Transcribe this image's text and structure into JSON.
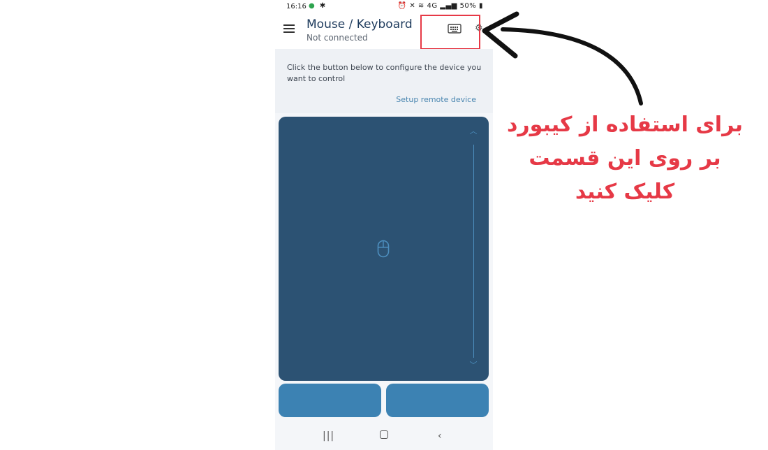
{
  "status_bar": {
    "time": "16:16",
    "battery": "50%",
    "signal_text": "4G"
  },
  "app_bar": {
    "title": "Mouse / Keyboard",
    "subtitle": "Not connected",
    "menu_icon": "hamburger-menu-icon",
    "keyboard_icon": "keyboard-icon",
    "settings_icon": "gear-icon"
  },
  "info_card": {
    "message": "Click the button below to configure the device you want to control",
    "action_label": "Setup remote device"
  },
  "touchpad": {
    "center_icon": "mouse-icon",
    "scroll_up_icon": "chevron-up-icon",
    "scroll_down_icon": "chevron-down-icon"
  },
  "nav_bar": {
    "recent_icon": "recent-apps-icon",
    "home_icon": "home-icon",
    "back_icon": "back-icon"
  },
  "annotation": {
    "lines": [
      "برای استفاده از کیبورد",
      "بر روی این قسمت",
      "کلیک کنید"
    ],
    "color": "#e63946"
  },
  "colors": {
    "touchpad_bg": "#2c5273",
    "mouse_button_bg": "#3c82b3",
    "accent_link": "#4a86b0"
  }
}
